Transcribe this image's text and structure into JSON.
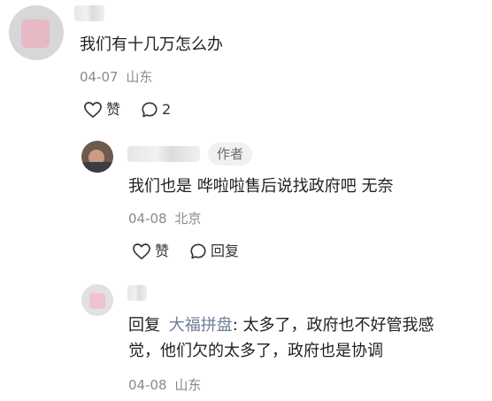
{
  "comment": {
    "text": "我们有十几万怎么办",
    "date": "04-07",
    "location": "山东",
    "like_label": "赞",
    "reply_count": "2",
    "icons": {
      "like": "heart-icon",
      "reply": "chat-bubble-icon"
    }
  },
  "replies": [
    {
      "badge": "作者",
      "text": "我们也是 哗啦啦售后说找政府吧 无奈",
      "date": "04-08",
      "location": "北京",
      "like_label": "赞",
      "reply_label": "回复"
    },
    {
      "reply_prefix": "回复",
      "reply_to": "大福拼盘",
      "text_line1": ": 太多了，政府也不好管我感",
      "text_line2": "觉，他们欠的太多了，政府也是协调",
      "date": "04-08",
      "location": "山东"
    }
  ],
  "colors": {
    "text": "#1f1f1f",
    "meta": "#8a8a8a",
    "reply_to_link": "#6d7d9a",
    "badge_bg": "#f1f1f1"
  }
}
